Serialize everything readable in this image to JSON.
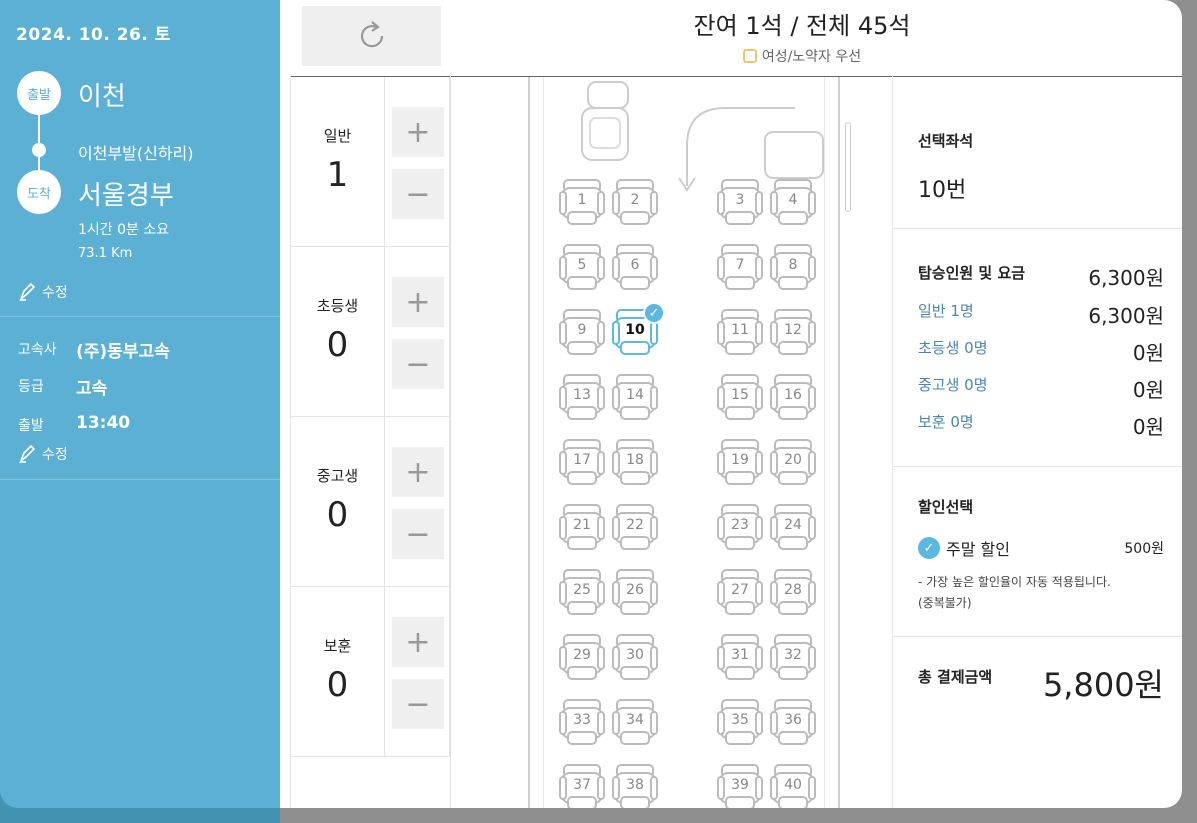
{
  "trip": {
    "date": "2024. 10. 26. 토",
    "depart_badge": "출발",
    "depart_city": "이천",
    "via_stop": "이천부발(신하리)",
    "arrive_badge": "도착",
    "arrive_city": "서울경부",
    "duration": "1시간 0분 소요",
    "distance": "73.1 Km",
    "edit_label": "수정"
  },
  "info": {
    "company_label": "고속사",
    "company_value": "(주)동부고속",
    "grade_label": "등급",
    "grade_value": "고속",
    "time_label": "출발",
    "time_value": "13:40",
    "edit_label": "수정"
  },
  "seat_status": "잔여 1석 / 전체 45석",
  "priority_label": "여성/노약자 우선",
  "passengers": [
    {
      "name": "일반",
      "count": "1"
    },
    {
      "name": "초등생",
      "count": "0"
    },
    {
      "name": "중고생",
      "count": "0"
    },
    {
      "name": "보훈",
      "count": "0"
    }
  ],
  "seat_rows": [
    [
      "1",
      "2",
      "3",
      "4"
    ],
    [
      "5",
      "6",
      "7",
      "8"
    ],
    [
      "9",
      "10",
      "11",
      "12"
    ],
    [
      "13",
      "14",
      "15",
      "16"
    ],
    [
      "17",
      "18",
      "19",
      "20"
    ],
    [
      "21",
      "22",
      "23",
      "24"
    ],
    [
      "25",
      "26",
      "27",
      "28"
    ],
    [
      "29",
      "30",
      "31",
      "32"
    ],
    [
      "33",
      "34",
      "35",
      "36"
    ],
    [
      "37",
      "38",
      "39",
      "40"
    ]
  ],
  "selected_seat": "10",
  "summary": {
    "selected_title": "선택좌석",
    "selected_value": "10번",
    "fare_title": "탑승인원 및 요금",
    "fare_total": "6,300원",
    "fare_rows": [
      {
        "label": "일반 1명",
        "value": "6,300원"
      },
      {
        "label": "초등생 0명",
        "value": "0원"
      },
      {
        "label": "중고생 0명",
        "value": "0원"
      },
      {
        "label": "보훈 0명",
        "value": "0원"
      }
    ],
    "discount_title": "할인선택",
    "discount_name": "주말 할인",
    "discount_value": "500원",
    "discount_note1": "- 가장 높은 할인율이 자동 적용됩니다.",
    "discount_note2": "(중복불가)",
    "total_label": "총 결제금액",
    "total_value": "5,800원"
  },
  "colors": {
    "panel": "#5bb0d3",
    "accent": "#5bb8e0",
    "link": "#4a87b0"
  },
  "icons": {
    "refresh": "refresh-icon",
    "edit": "pencil-icon",
    "check": "check-icon",
    "plus": "plus-icon",
    "minus": "minus-icon"
  }
}
